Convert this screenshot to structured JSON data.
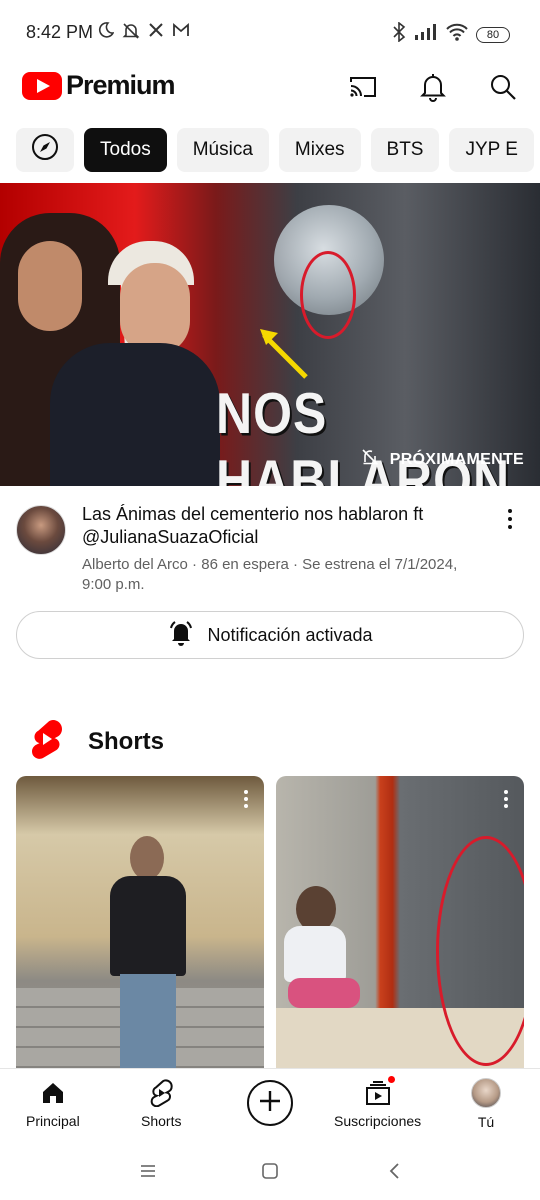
{
  "status_bar": {
    "time": "8:42 PM",
    "left_icons": [
      "moon-icon",
      "bell-off-icon",
      "x-icon",
      "gmail-icon"
    ],
    "right_icons": [
      "bluetooth-icon",
      "signal-icon",
      "wifi-icon"
    ],
    "battery": "80"
  },
  "header": {
    "logo_text": "Premium",
    "icons": [
      "cast-icon",
      "bell-icon",
      "search-icon"
    ]
  },
  "chips": {
    "explore_icon": "compass-icon",
    "items": [
      {
        "label": "Todos",
        "active": true
      },
      {
        "label": "Música",
        "active": false
      },
      {
        "label": "Mixes",
        "active": false
      },
      {
        "label": "BTS",
        "active": false
      },
      {
        "label": "JYP E",
        "active": false
      }
    ]
  },
  "featured_video": {
    "thumbnail_title": "NOS HABLARON",
    "status_badge": "PRÓXIMAMENTE",
    "title": "Las Ánimas del cementerio nos hablaron ft @JulianaSuazaOficial",
    "subtitle": "Alberto del Arco · 86 en espera · Se estrena el 7/1/2024, 9:00 p.m.",
    "notify_button": "Notificación activada"
  },
  "shorts": {
    "title": "Shorts",
    "items": [
      {
        "name": "short-1"
      },
      {
        "name": "short-2"
      }
    ]
  },
  "bottom_nav": {
    "items": [
      {
        "label": "Principal",
        "icon": "home-icon"
      },
      {
        "label": "Shorts",
        "icon": "shorts-icon"
      },
      {
        "label": "",
        "icon": "create-icon"
      },
      {
        "label": "Suscripciones",
        "icon": "subscriptions-icon"
      },
      {
        "label": "Tú",
        "icon": "avatar"
      }
    ]
  },
  "colors": {
    "brand_red": "#ff0000",
    "text_primary": "#0f0f0f",
    "text_secondary": "#606060",
    "chip_bg": "#f2f2f2",
    "chip_active_bg": "#0f0f0f"
  }
}
